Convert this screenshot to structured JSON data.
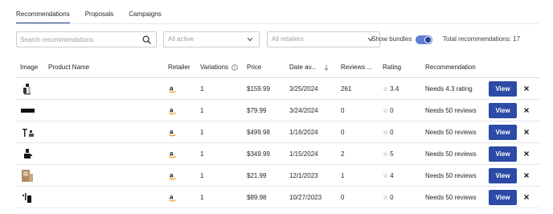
{
  "tabs": [
    {
      "label": "Recommendations",
      "active": true
    },
    {
      "label": "Proposals",
      "active": false
    },
    {
      "label": "Campaigns",
      "active": false
    }
  ],
  "toolbar": {
    "search_placeholder": "Search recommendations",
    "status_filter": "All active",
    "retailer_filter": "All retailers",
    "show_bundles_label": "Show bundles",
    "show_bundles_on": true,
    "total_label": "Total recommendations: 17"
  },
  "table": {
    "columns": {
      "image": "Image",
      "product_name": "Product Name",
      "retailer": "Retailer",
      "variations": "Variations",
      "price": "Price",
      "date": "Date av...",
      "reviews": "Reviews ...",
      "rating": "Rating",
      "recommendation": "Recommendation"
    },
    "view_label": "View",
    "rows": [
      {
        "variations": "1",
        "price": "$159.99",
        "date": "3/25/2024",
        "reviews": "261",
        "rating": "3.4",
        "recommendation": "Needs 4.3 rating"
      },
      {
        "variations": "1",
        "price": "$79.99",
        "date": "3/24/2024",
        "reviews": "0",
        "rating": "0",
        "recommendation": "Needs 50 reviews"
      },
      {
        "variations": "1",
        "price": "$499.98",
        "date": "1/16/2024",
        "reviews": "0",
        "rating": "0",
        "recommendation": "Needs 50 reviews"
      },
      {
        "variations": "1",
        "price": "$349.99",
        "date": "1/15/2024",
        "reviews": "2",
        "rating": "5",
        "recommendation": "Needs 50 reviews"
      },
      {
        "variations": "1",
        "price": "$21.99",
        "date": "12/1/2023",
        "reviews": "1",
        "rating": "4",
        "recommendation": "Needs 50 reviews"
      },
      {
        "variations": "1",
        "price": "$89.98",
        "date": "10/27/2023",
        "reviews": "0",
        "rating": "0",
        "recommendation": "Needs 50 reviews"
      }
    ]
  },
  "colors": {
    "accent": "#2c4aa6",
    "toggle_track": "#5e80d6"
  },
  "icons": {
    "search": "search-icon",
    "chevron": "chevron-down-icon",
    "info": "info-icon",
    "sort": "sort-arrow-icon",
    "retailer": "amazon-logo-icon",
    "star": "star-icon",
    "close": "close-icon"
  }
}
